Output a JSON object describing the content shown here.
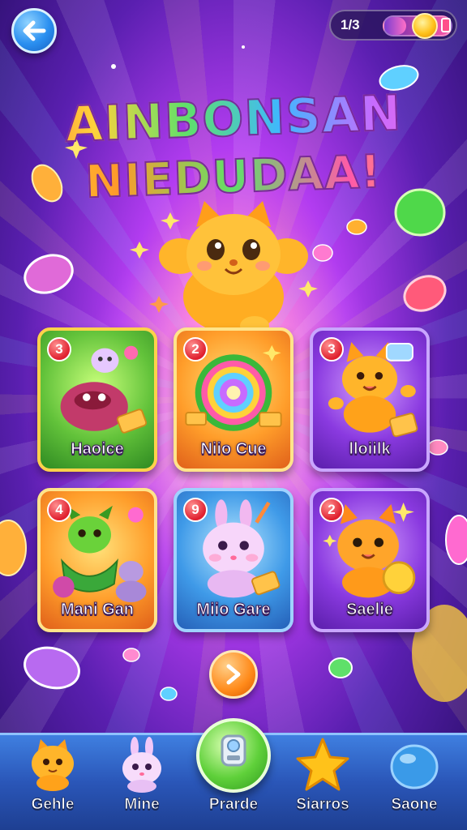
{
  "header": {
    "back_icon": "back-arrow-icon",
    "counter_text": "1/3",
    "counter_progress": 0.33,
    "coin_icon": "coin-icon"
  },
  "title": {
    "line1": "AINBONSAN",
    "line2": "NIEDUDAA!"
  },
  "cards": [
    {
      "badge": "3",
      "label": "Haoice",
      "theme": "green",
      "art": "pink-creature-icon"
    },
    {
      "badge": "2",
      "label": "Niio Cue",
      "theme": "orange",
      "art": "rainbow-swirl-icon"
    },
    {
      "badge": "3",
      "label": "lloiilk",
      "theme": "purple",
      "art": "orange-cat-icon"
    },
    {
      "badge": "4",
      "label": "Mani Gan",
      "theme": "orange",
      "art": "green-dragon-icon"
    },
    {
      "badge": "9",
      "label": "Miio Gare",
      "theme": "blue",
      "art": "pink-bunny-icon"
    },
    {
      "badge": "2",
      "label": "Saelie",
      "theme": "purple",
      "art": "orange-cat-coin-icon"
    }
  ],
  "play_icon": "play-arrow-icon",
  "bottom_nav": [
    {
      "label": "Gehle",
      "icon": "cat-icon"
    },
    {
      "label": "Mine",
      "icon": "bunny-icon"
    },
    {
      "label": "Prarde",
      "icon": "robot-icon"
    },
    {
      "label": "Siarros",
      "icon": "star-icon"
    },
    {
      "label": "Saone",
      "icon": "blue-gem-icon"
    }
  ],
  "colors": {
    "accent_blue": "#2a8ff0",
    "accent_orange": "#ff8a1a",
    "nav_bg": "#2a56b8",
    "badge_red": "#e0202f"
  }
}
